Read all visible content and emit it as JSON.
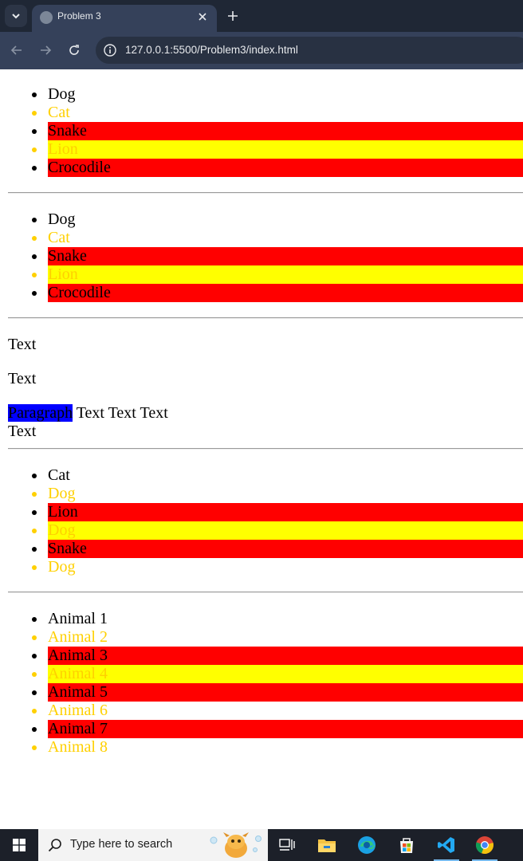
{
  "browser": {
    "tab_title": "Problem 3",
    "url": "127.0.0.1:5500/Problem3/index.html"
  },
  "icons": {
    "tab_search": "chevron-down-icon",
    "favicon": "globe-icon",
    "close": "close-icon",
    "new_tab": "plus-icon",
    "back": "arrow-left-icon",
    "forward": "arrow-right-icon",
    "reload": "reload-icon",
    "site_info": "info-icon"
  },
  "colors": {
    "bullet_odd": "#000000",
    "bullet_even": "#ffd000",
    "highlight_red": "#ff0000",
    "highlight_yellow": "#ffff00",
    "paragraph_highlight": "#0000ff"
  },
  "lists": [
    [
      "Dog",
      "Cat",
      "Snake",
      "Lion",
      "Crocodile"
    ],
    [
      "Dog",
      "Cat",
      "Snake",
      "Lion",
      "Crocodile"
    ],
    [
      "Cat",
      "Dog",
      "Lion",
      "Dog",
      "Snake",
      "Dog"
    ],
    [
      "Animal 1",
      "Animal 2",
      "Animal 3",
      "Animal 4",
      "Animal 5",
      "Animal 6",
      "Animal 7",
      "Animal 8"
    ]
  ],
  "paragraphs": {
    "text1": "Text",
    "text2": "Text",
    "highlighted": "Paragraph",
    "rest": " Text Text Text",
    "text_after_break": "Text"
  },
  "taskbar": {
    "search_placeholder": "Type here to search",
    "apps": [
      "task-view-icon",
      "file-explorer-icon",
      "edge-icon",
      "store-icon",
      "vscode-icon",
      "chrome-icon"
    ]
  }
}
